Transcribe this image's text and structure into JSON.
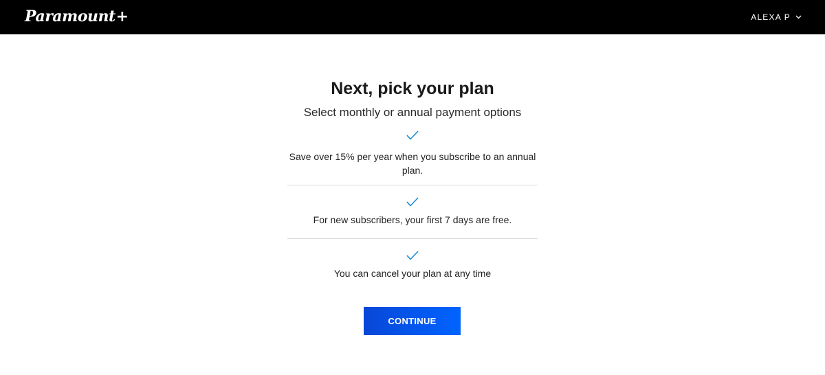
{
  "header": {
    "logo_text": "Paramount",
    "logo_plus": "+",
    "user_name": "ALEXA P"
  },
  "main": {
    "title": "Next, pick your plan",
    "subtitle": "Select monthly or annual payment options",
    "benefits": [
      {
        "icon": "check-icon",
        "text": "Save over 15% per year when you subscribe to an annual plan."
      },
      {
        "icon": "check-icon",
        "text": "For new subscribers, your first 7 days are free."
      },
      {
        "icon": "check-icon",
        "text": "You can cancel your plan at any time"
      }
    ],
    "continue_label": "CONTINUE"
  },
  "colors": {
    "header_bg": "#000000",
    "check_color": "#0a84d0",
    "button_start": "#0847d8",
    "button_end": "#0064ff",
    "divider": "#d9d9d9"
  }
}
